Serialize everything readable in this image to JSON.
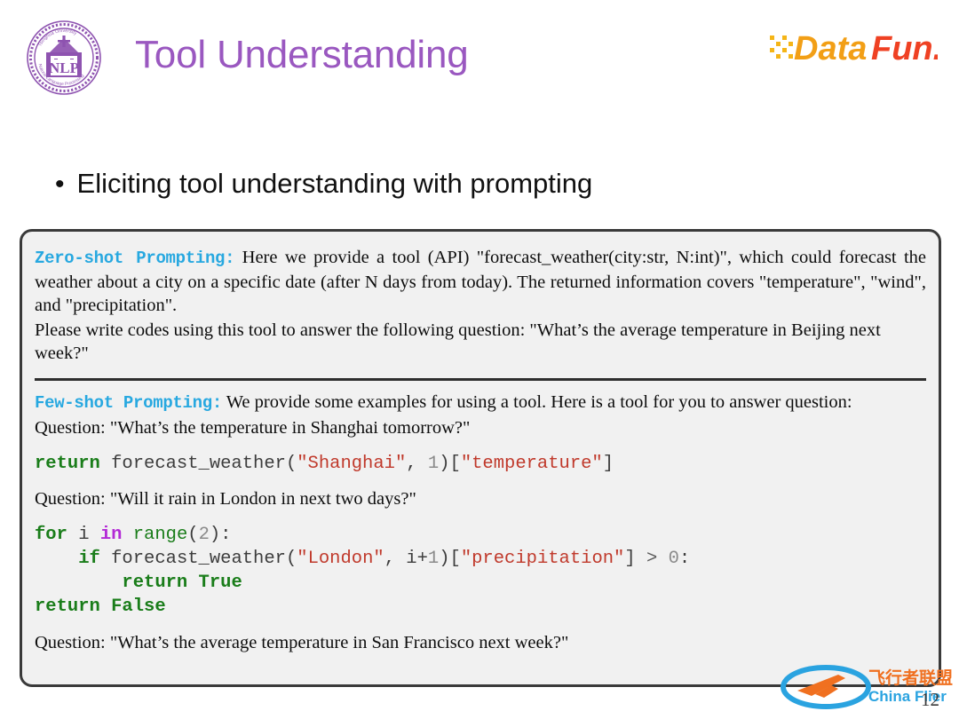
{
  "header": {
    "title": "Tool Understanding",
    "title_color": "#9a58c0",
    "nlp_logo_text": "NLP",
    "nlp_logo_outer_top": "Tsinghua University",
    "nlp_logo_outer_bottom": "Natural Language Processing",
    "brand_logo_text": "DataFun.",
    "brand_colors": {
      "yellow": "#f5b517",
      "orange": "#f07d1a",
      "red": "#ef4123"
    }
  },
  "bullet": {
    "dot": "•",
    "text": "Eliciting tool understanding with prompting"
  },
  "prompt_box": {
    "zero_shot": {
      "label": "Zero-shot Prompting:",
      "label_color": "#27a8e0",
      "paragraph_1": "Here we provide a tool (API) \"forecast_weather(city:str, N:int)\", which could forecast the weather about a city on a specific date (after N days from today).  The returned information covers \"temperature\", \"wind\", and \"precipitation\".",
      "paragraph_2": "Please write codes using this tool to answer the following question: \"What’s the average temperature in Beijing next week?\""
    },
    "few_shot": {
      "label": "Few-shot Prompting:",
      "label_color": "#27a8e0",
      "paragraph_1": "We provide some examples for using a tool. Here is a tool for you to answer question:",
      "question_1": "Question: \"What’s the temperature in Shanghai tomorrow?\"",
      "question_2": "Question: \"Will it rain in London in next two days?\"",
      "question_3": "Question: \"What’s the average temperature in San Francisco next week?\""
    },
    "code_block_1": {
      "lines": [
        [
          {
            "t": "return",
            "c": "kw"
          },
          {
            "t": " forecast_weather(",
            "c": "pln"
          },
          {
            "t": "\"Shanghai\"",
            "c": "str"
          },
          {
            "t": ", ",
            "c": "pln"
          },
          {
            "t": "1",
            "c": "num"
          },
          {
            "t": ")[",
            "c": "pln"
          },
          {
            "t": "\"temperature\"",
            "c": "str"
          },
          {
            "t": "]",
            "c": "pln"
          }
        ]
      ]
    },
    "code_block_2": {
      "lines": [
        [
          {
            "t": "for",
            "c": "kw"
          },
          {
            "t": " i ",
            "c": "pln"
          },
          {
            "t": "in",
            "c": "kw2"
          },
          {
            "t": " ",
            "c": "pln"
          },
          {
            "t": "range",
            "c": "fn"
          },
          {
            "t": "(",
            "c": "pln"
          },
          {
            "t": "2",
            "c": "num"
          },
          {
            "t": "):",
            "c": "pln"
          }
        ],
        [
          {
            "t": "    ",
            "c": "pln"
          },
          {
            "t": "if",
            "c": "kw"
          },
          {
            "t": " forecast_weather(",
            "c": "pln"
          },
          {
            "t": "\"London\"",
            "c": "str"
          },
          {
            "t": ", i+",
            "c": "pln"
          },
          {
            "t": "1",
            "c": "num"
          },
          {
            "t": ")[",
            "c": "pln"
          },
          {
            "t": "\"precipitation\"",
            "c": "str"
          },
          {
            "t": "] ",
            "c": "pln"
          },
          {
            "t": "> ",
            "c": "op"
          },
          {
            "t": "0",
            "c": "num"
          },
          {
            "t": ":",
            "c": "pln"
          }
        ],
        [
          {
            "t": "        ",
            "c": "pln"
          },
          {
            "t": "return True",
            "c": "kw"
          }
        ],
        [
          {
            "t": "return False",
            "c": "kw"
          }
        ]
      ]
    }
  },
  "watermark": {
    "text_cn": "飞行者联盟",
    "text_en": "China Flier",
    "color_cn": "#f07020",
    "color_en": "#2aa3e0"
  },
  "footer": {
    "page_number": "12"
  }
}
